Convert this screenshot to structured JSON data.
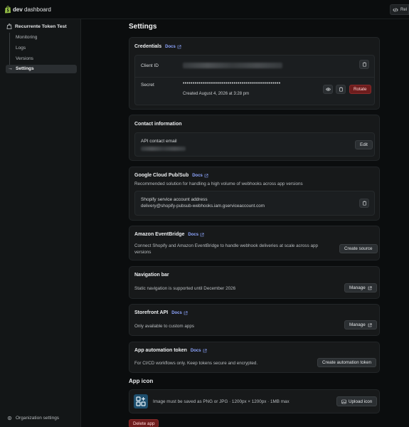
{
  "topbar": {
    "brand_bold": "dev",
    "brand_rest": " dashboard",
    "release_label": "Rel"
  },
  "sidebar": {
    "app_name": "Recurrente Token Test",
    "items": [
      {
        "label": "Monitoring"
      },
      {
        "label": "Logs"
      },
      {
        "label": "Versions"
      },
      {
        "label": "Settings"
      }
    ],
    "active": "Settings",
    "org_settings": "Organization settings"
  },
  "page": {
    "title": "Settings"
  },
  "credentials": {
    "title": "Credentials",
    "docs": "Docs",
    "client_id_label": "Client ID",
    "secret_label": "Secret",
    "secret_mask": "••••••••••••••••••••••••••••••••••••••••••••••••••",
    "created": "Created August 4, 2026 at 3:28 pm",
    "rotate": "Rotate"
  },
  "contact": {
    "title": "Contact information",
    "api_email_label": "API contact email",
    "edit": "Edit"
  },
  "pubsub": {
    "title": "Google Cloud Pub/Sub",
    "docs": "Docs",
    "description": "Recommended solution for handling a high volume of webhooks across app versions",
    "service_label": "Shopify service account address",
    "service_value": "delivery@shopify-pubsub-webhooks.iam.gserviceaccount.com"
  },
  "eventbridge": {
    "title": "Amazon EventBridge",
    "docs": "Docs",
    "description": "Connect Shopify and Amazon EventBridge to handle webhook deliveries at scale across app versions",
    "button": "Create source"
  },
  "navbar": {
    "title": "Navigation bar",
    "description": "Static navigation is supported until December 2026",
    "button": "Manage"
  },
  "storefront": {
    "title": "Storefront API",
    "docs": "Docs",
    "description": "Only available to custom apps",
    "button": "Manage"
  },
  "automation": {
    "title": "App automation token",
    "docs": "Docs",
    "description": "For CI/CD workflows only. Keep tokens secure and encrypted.",
    "button": "Create automation token"
  },
  "app_icon": {
    "title": "App icon",
    "requirements": "Image must be saved as PNG or JPG · 1200px × 1200px · 1MB max",
    "upload": "Upload icon"
  },
  "delete_app": "Delete app",
  "colors": {
    "accent_link": "#8ea6ff",
    "danger": "#6e1d1d",
    "background": "#0b0d0e",
    "card": "#17191a"
  }
}
